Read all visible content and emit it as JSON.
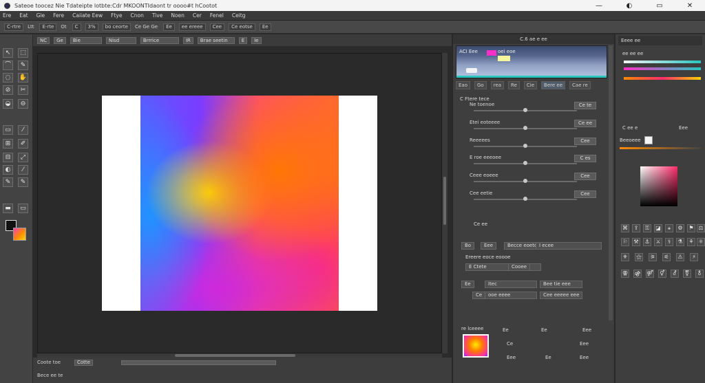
{
  "window": {
    "title": "Sateoe toocez Nie Tdateipte lotbte:Cdr MKOONTIdaont tr oooo#t hCootot",
    "controls": [
      "—",
      "◐",
      "▭",
      "✕"
    ]
  },
  "menu": {
    "items": [
      "Ere",
      "Eat",
      "Gle",
      "Fere",
      "Caiiate Eew",
      "Ftye",
      "Cnon",
      "Tive",
      "Noen",
      "Cer",
      "Fenel",
      "Ceitg"
    ]
  },
  "options_bar": {
    "items": [
      "C-rtre",
      "Ltt",
      "E-rte",
      "Ot",
      "C",
      "3%",
      "bo ceorte",
      "Ce Ge Ge",
      "Ee",
      "ee ereee",
      "Cee",
      "Ce eotse",
      "Ee"
    ]
  },
  "doc_bar": {
    "fields": [
      "NC",
      "Ge",
      "Bie",
      "Nisd",
      "Brrrice",
      "IR",
      "Brae seetin",
      "E",
      "Ie"
    ]
  },
  "tools": {
    "rows": [
      [
        "↖",
        "⬚"
      ],
      [
        "⌒",
        "✎"
      ],
      [
        "◌",
        "✋"
      ],
      [
        "⊘",
        "✂"
      ],
      [
        "◒",
        "⊖"
      ],
      [
        "▭",
        "⁄"
      ],
      [
        "⊞",
        "✐"
      ],
      [
        "⊟",
        "⤢"
      ],
      [
        "◐",
        "⁄"
      ],
      [
        "✎",
        "✎"
      ],
      [
        "▬",
        "▭"
      ]
    ],
    "foreground_color": "#111111",
    "background_colors": [
      "#ff3fb0",
      "#ff8a00",
      "#ffd400"
    ]
  },
  "status": {
    "zoom_label": "Coote toe",
    "field": "Cotte",
    "bottom_label": "Bece ee te"
  },
  "mid_panel": {
    "tabs": [
      "C.6 ae e ee"
    ],
    "preview": {
      "label": "ACI Eee",
      "label2": "oei   eoe"
    },
    "sub_tabs": [
      "Eao",
      "Go",
      "rea",
      "Re",
      "Cie",
      "Bere ee",
      "Cae re"
    ],
    "adj_title": "C  Ftere tece",
    "sliders": [
      {
        "label": "Ne toenoe",
        "value": "Ce te",
        "level": 0.5
      },
      {
        "label": "Etei eoteeee",
        "value": "Ce ee",
        "level": 0.5
      },
      {
        "label": "Reeeees",
        "value": "Cee",
        "level": 0.5
      },
      {
        "label": "E roe eeeoee",
        "value": "C es",
        "level": 0.5
      },
      {
        "label": "Ceee eoeee",
        "value": "Cee",
        "level": 0.5
      },
      {
        "label": "Cee eetie",
        "value": "Cee",
        "level": 0.5
      }
    ],
    "adj_foot": "Ce ee",
    "lower": {
      "row1": [
        "Bo",
        "Eee",
        "Becce eoetoe",
        "I ecee"
      ],
      "row2": "Ereere eoce  eoooe",
      "row3": [
        "E Ctete",
        "Cooee"
      ],
      "row4": [
        "Ee",
        "Itec",
        "Bee tie eee"
      ],
      "row5": [
        "Ce",
        "ooe eeee",
        "Cee eeeee eee"
      ]
    },
    "thumb": {
      "label": "re lceeee",
      "cols": [
        "Ee",
        "Ee",
        "Eee"
      ],
      "row1": [
        "Ce",
        "Eee"
      ],
      "row2": [
        "Eee",
        "Ee",
        "Eee"
      ]
    }
  },
  "right_panel": {
    "header": "Eeee ee",
    "labels": [
      "ee ee ee",
      "C ee e",
      "Eee"
    ],
    "color_label": "Beeoeee",
    "gradient_colors": [
      "#f4f4f4",
      "#27c7c0",
      "#ff2ec9",
      "#ff8a00"
    ],
    "icon_rows": [
      [
        "⌘",
        "⇪",
        "⚿",
        "◪",
        "⚹",
        "⚙",
        "⚑",
        "⚖"
      ],
      [
        "⚐",
        "⚒",
        "⚓",
        "⚔",
        "⚕",
        "⚗",
        "⚘",
        "⚛"
      ],
      [
        "⚜",
        "⚝",
        "⚞",
        "⚟",
        "⚠",
        "⚡"
      ],
      [
        "⚢",
        "⚣",
        "⚤",
        "⚥",
        "⚦",
        "⚧",
        "⚨"
      ]
    ]
  }
}
